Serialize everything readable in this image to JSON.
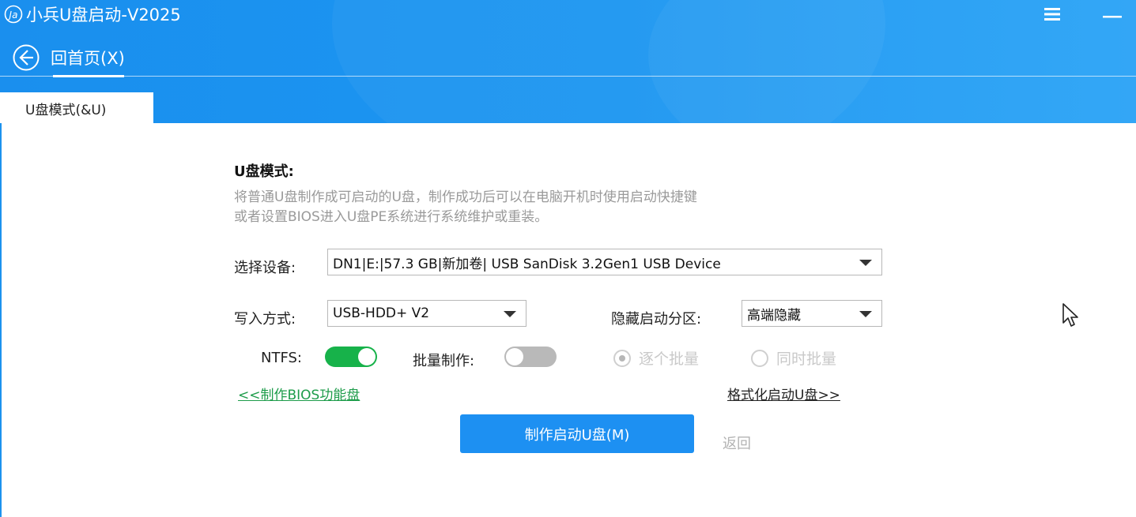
{
  "window": {
    "title": "小兵U盘启动-V2025",
    "logo_icon": "app-logo-icon",
    "menu_icon": "hamburger-menu-icon",
    "minimize_icon": "minimize-icon",
    "header_color": "#1c92ee"
  },
  "nav": {
    "back_label": "回首页(X)",
    "back_icon": "arrow-left-circle-icon"
  },
  "tabs": [
    {
      "label": "U盘模式(&U)",
      "active": true
    }
  ],
  "main": {
    "section_title": "U盘模式:",
    "description_line1": "将普通U盘制作成可启动的U盘，制作成功后可以在电脑开机时使用启动快捷键",
    "description_line2": "或者设置BIOS进入U盘PE系统进行系统维护或重装。",
    "device": {
      "label": "选择设备:",
      "value": "DN1|E:|57.3 GB|新加卷| USB  SanDisk 3.2Gen1 USB Device"
    },
    "write_mode": {
      "label": "写入方式:",
      "value": "USB-HDD+ V2"
    },
    "hidden_partition": {
      "label": "隐藏启动分区:",
      "value": "高端隐藏"
    },
    "ntfs": {
      "label": "NTFS:",
      "on": true
    },
    "batch": {
      "label": "批量制作:",
      "on": false
    },
    "radio_sequential": {
      "label": "逐个批量",
      "checked": true,
      "enabled": false
    },
    "radio_simultaneous": {
      "label": "同时批量",
      "checked": false,
      "enabled": false
    },
    "bios_link": "<<制作BIOS功能盘",
    "format_link": "格式化启动U盘>>",
    "primary_button": "制作启动U盘(M)",
    "back_button": "返回",
    "accent_color": "#1d90f2",
    "toggle_on_color": "#17b24a"
  }
}
